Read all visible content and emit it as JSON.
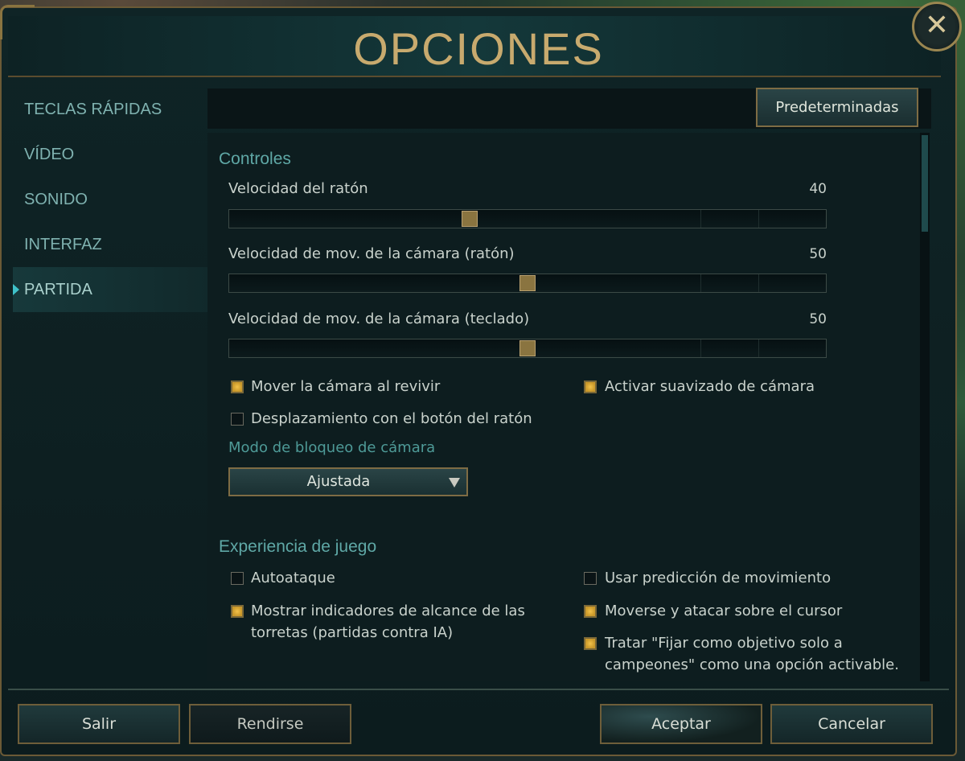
{
  "window": {
    "title": "OPCIONES"
  },
  "close": {
    "icon": "close-icon",
    "glyph": "✕"
  },
  "sidebar": {
    "items": [
      {
        "label": "TECLAS RÁPIDAS",
        "active": false
      },
      {
        "label": "VÍDEO",
        "active": false
      },
      {
        "label": "SONIDO",
        "active": false
      },
      {
        "label": "INTERFAZ",
        "active": false
      },
      {
        "label": "PARTIDA",
        "active": true
      }
    ]
  },
  "toolbar": {
    "defaults_label": "Predeterminadas"
  },
  "controls": {
    "title": "Controles",
    "sliders": [
      {
        "label": "Velocidad del ratón",
        "value": "40"
      },
      {
        "label": "Velocidad de mov. de la cámara (ratón)",
        "value": "50"
      },
      {
        "label": "Velocidad de mov. de la cámara (teclado)",
        "value": "50"
      }
    ],
    "checkboxes": [
      {
        "label": "Mover la cámara al revivir",
        "checked": true
      },
      {
        "label": "Activar suavizado de cámara",
        "checked": true
      },
      {
        "label": "Desplazamiento con el botón del ratón",
        "checked": false
      }
    ],
    "lock_mode_label": "Modo de bloqueo de cámara",
    "lock_mode_value": "Ajustada"
  },
  "gameplay": {
    "title": "Experiencia de juego",
    "checkboxes": [
      {
        "label": "Autoataque",
        "checked": false
      },
      {
        "label": "Usar predicción de movimiento",
        "checked": false
      },
      {
        "label_line1": "Mostrar indicadores de alcance de las",
        "label_line2": "torretas (partidas contra IA)",
        "checked": true
      },
      {
        "label": "Moverse y atacar sobre el cursor",
        "checked": true
      },
      {
        "label_line1": "Tratar \"Fijar como objetivo solo a",
        "label_line2": "campeones\" como una opción activable.",
        "checked": true
      }
    ]
  },
  "footer": {
    "exit_label": "Salir",
    "surrender_label": "Rendirse",
    "accept_label": "Aceptar",
    "cancel_label": "Cancelar"
  },
  "colors": {
    "gold": "#c8aa6e",
    "teal_text": "#5fa8a6",
    "checkbox_on": "#f2c24a"
  }
}
